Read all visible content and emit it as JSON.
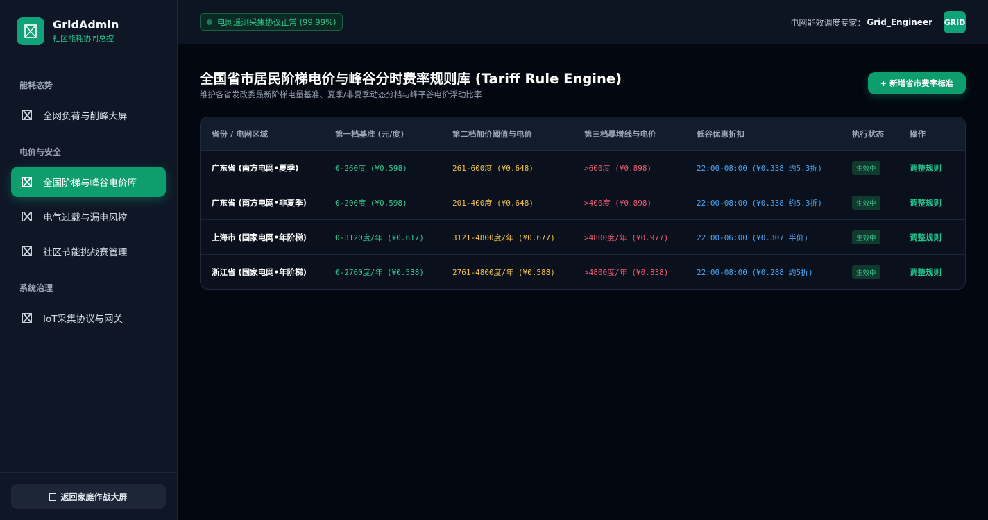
{
  "brand": {
    "title": "GridAdmin",
    "subtitle": "社区能耗协同总控",
    "logo_icon": "grid-logo-icon"
  },
  "nav": {
    "sections": [
      {
        "label": "能耗态势"
      },
      {
        "label": "电价与安全"
      },
      {
        "label": "系统治理"
      }
    ],
    "items": [
      {
        "label": "全网负荷与削峰大屏",
        "icon": "placeholder-icon",
        "active": false
      },
      {
        "label": "全国阶梯与峰谷电价库",
        "icon": "placeholder-icon",
        "active": true
      },
      {
        "label": "电气过载与漏电风控",
        "icon": "placeholder-icon",
        "active": false
      },
      {
        "label": "社区节能挑战赛管理",
        "icon": "placeholder-icon",
        "active": false
      },
      {
        "label": "IoT采集协议与网关",
        "icon": "placeholder-icon",
        "active": false
      }
    ],
    "back_label": "返回家庭作战大屏"
  },
  "topbar": {
    "status_text": "电网遥测采集协议正常 (99.99%)",
    "user_label": "电网能效调度专家：",
    "user_name": "Grid_Engineer",
    "avatar_text": "GRID"
  },
  "page": {
    "title": "全国省市居民阶梯电价与峰谷分时费率规则库 (Tariff Rule Engine)",
    "subtitle": "维护各省发改委最新阶梯电量基准、夏季/非夏季动态分档与峰平谷电价浮动比率",
    "add_button": "+ 新增省市费率标准"
  },
  "table": {
    "headers": [
      "省份 / 电网区域",
      "第一档基准 (元/度)",
      "第二档加价阈值与电价",
      "第三档暴增线与电价",
      "低谷优惠折扣",
      "执行状态",
      "操作"
    ],
    "rows": [
      {
        "region": "广东省 (南方电网•夏季)",
        "tier1": "0-260度 (¥0.598)",
        "tier2": "261-600度 (¥0.648)",
        "tier3": ">600度 (¥0.898)",
        "valley": "22:00-08:00 (¥0.338 约5.3折)",
        "status": "生效中",
        "action": "调整规则"
      },
      {
        "region": "广东省 (南方电网•非夏季)",
        "tier1": "0-200度 (¥0.598)",
        "tier2": "201-400度 (¥0.648)",
        "tier3": ">400度 (¥0.898)",
        "valley": "22:00-08:00 (¥0.338 约5.3折)",
        "status": "生效中",
        "action": "调整规则"
      },
      {
        "region": "上海市 (国家电网•年阶梯)",
        "tier1": "0-3120度/年 (¥0.617)",
        "tier2": "3121-4800度/年 (¥0.677)",
        "tier3": ">4800度/年 (¥0.977)",
        "valley": "22:00-06:00 (¥0.307 半价)",
        "status": "生效中",
        "action": "调整规则"
      },
      {
        "region": "浙江省 (国家电网•年阶梯)",
        "tier1": "0-2760度/年 (¥0.538)",
        "tier2": "2761-4800度/年 (¥0.588)",
        "tier3": ">4800度/年 (¥0.838)",
        "valley": "22:00-08:00 (¥0.288 约5折)",
        "status": "生效中",
        "action": "调整规则"
      }
    ]
  },
  "colors": {
    "accent": "#10a37a",
    "tier1": "#34c98e",
    "tier2": "#f3c04a",
    "tier3": "#ef5a6f",
    "valley": "#4aa3f0"
  }
}
